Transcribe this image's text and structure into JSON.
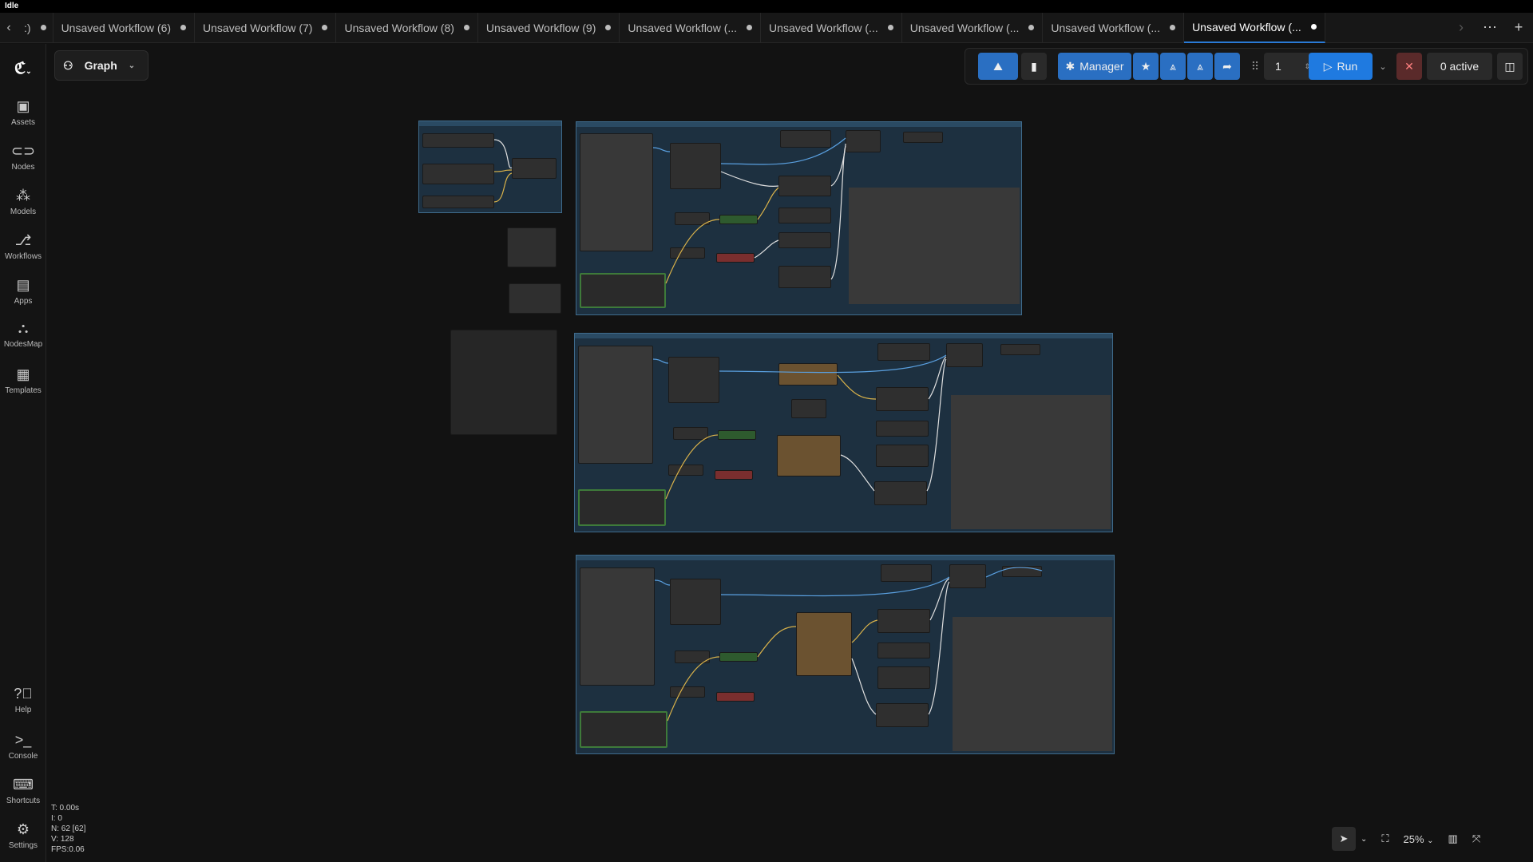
{
  "window": {
    "status": "Idle"
  },
  "tabs": [
    {
      "label": "Unsaved Workflow (6)"
    },
    {
      "label": "Unsaved Workflow (7)"
    },
    {
      "label": "Unsaved Workflow (8)"
    },
    {
      "label": "Unsaved Workflow (9)"
    },
    {
      "label": "Unsaved Workflow (..."
    },
    {
      "label": "Unsaved Workflow (..."
    },
    {
      "label": "Unsaved Workflow (..."
    },
    {
      "label": "Unsaved Workflow (..."
    },
    {
      "label": "Unsaved Workflow (...",
      "active": true
    }
  ],
  "tab_prefix": ":)",
  "sidebar": {
    "items": [
      {
        "label": "Assets",
        "icon": "image-icon"
      },
      {
        "label": "Nodes",
        "icon": "nodes-icon"
      },
      {
        "label": "Models",
        "icon": "models-icon"
      },
      {
        "label": "Workflows",
        "icon": "workflows-icon"
      },
      {
        "label": "Apps",
        "icon": "apps-icon"
      },
      {
        "label": "NodesMap",
        "icon": "nodesmap-icon"
      },
      {
        "label": "Templates",
        "icon": "templates-icon"
      }
    ],
    "bottom_items": [
      {
        "label": "Help",
        "icon": "help-icon"
      },
      {
        "label": "Console",
        "icon": "console-icon"
      },
      {
        "label": "Shortcuts",
        "icon": "keyboard-icon"
      },
      {
        "label": "Settings",
        "icon": "gear-icon"
      }
    ]
  },
  "graph_menu": {
    "label": "Graph"
  },
  "toolbar": {
    "manager_label": "Manager",
    "batch_count": "1",
    "run_label": "Run",
    "active_label": "0 active"
  },
  "stats": {
    "t": "T: 0.00s",
    "i": "I: 0",
    "n": "N: 62 [62]",
    "v": "V: 128",
    "fps": "FPS:0.06"
  },
  "zoom": {
    "level": "25%"
  },
  "colors": {
    "accent": "#2a6fc2",
    "group_fill": "#1d3040",
    "group_border": "#3f6b8c"
  }
}
